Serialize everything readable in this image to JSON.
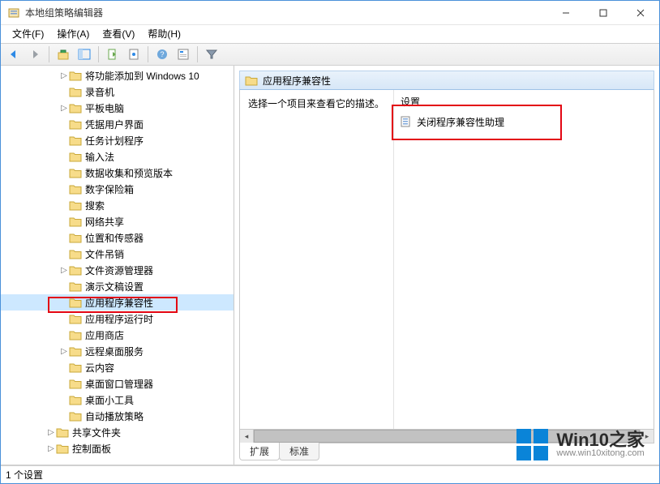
{
  "title": "本地组策略编辑器",
  "menus": {
    "file": "文件(F)",
    "action": "操作(A)",
    "view": "查看(V)",
    "help": "帮助(H)"
  },
  "tree": {
    "items": [
      {
        "label": "将功能添加到 Windows 10",
        "indent": 4,
        "exp": "▷"
      },
      {
        "label": "录音机",
        "indent": 4,
        "exp": ""
      },
      {
        "label": "平板电脑",
        "indent": 4,
        "exp": "▷"
      },
      {
        "label": "凭据用户界面",
        "indent": 4,
        "exp": ""
      },
      {
        "label": "任务计划程序",
        "indent": 4,
        "exp": ""
      },
      {
        "label": "输入法",
        "indent": 4,
        "exp": ""
      },
      {
        "label": "数据收集和预览版本",
        "indent": 4,
        "exp": ""
      },
      {
        "label": "数字保险箱",
        "indent": 4,
        "exp": ""
      },
      {
        "label": "搜索",
        "indent": 4,
        "exp": ""
      },
      {
        "label": "网络共享",
        "indent": 4,
        "exp": ""
      },
      {
        "label": "位置和传感器",
        "indent": 4,
        "exp": ""
      },
      {
        "label": "文件吊销",
        "indent": 4,
        "exp": ""
      },
      {
        "label": "文件资源管理器",
        "indent": 4,
        "exp": "▷"
      },
      {
        "label": "演示文稿设置",
        "indent": 4,
        "exp": ""
      },
      {
        "label": "应用程序兼容性",
        "indent": 4,
        "exp": "",
        "selected": true
      },
      {
        "label": "应用程序运行时",
        "indent": 4,
        "exp": ""
      },
      {
        "label": "应用商店",
        "indent": 4,
        "exp": ""
      },
      {
        "label": "远程桌面服务",
        "indent": 4,
        "exp": "▷"
      },
      {
        "label": "云内容",
        "indent": 4,
        "exp": ""
      },
      {
        "label": "桌面窗口管理器",
        "indent": 4,
        "exp": ""
      },
      {
        "label": "桌面小工具",
        "indent": 4,
        "exp": ""
      },
      {
        "label": "自动播放策略",
        "indent": 4,
        "exp": ""
      },
      {
        "label": "共享文件夹",
        "indent": 3,
        "exp": "▷"
      },
      {
        "label": "控制面板",
        "indent": 3,
        "exp": "▷"
      }
    ]
  },
  "right": {
    "header": "应用程序兼容性",
    "hint": "选择一个项目来查看它的描述。",
    "settings_header": "设置",
    "settings": [
      {
        "label": "关闭程序兼容性助理"
      }
    ]
  },
  "tabs": {
    "extended": "扩展",
    "standard": "标准"
  },
  "status": "1 个设置",
  "watermark": {
    "big": "Win10之家",
    "small": "www.win10xitong.com"
  }
}
